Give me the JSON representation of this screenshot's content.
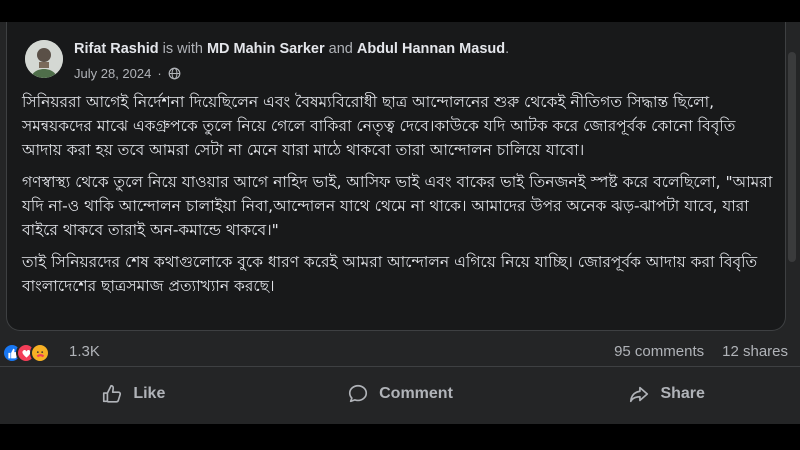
{
  "post": {
    "author": "Rifat Rashid",
    "with_text": "is with",
    "tagged_1": "MD Mahin Sarker",
    "and_text": "and",
    "tagged_2": "Abdul Hannan Masud",
    "date": "July 28, 2024",
    "separator": "·",
    "privacy_icon": "globe-icon",
    "paragraphs": [
      "সিনিয়ররা আগেই নির্দেশনা দিয়েছিলেন এবং বৈষম্যবিরোধী ছাত্র আন্দোলনের শুরু থেকেই নীতিগত সিদ্ধান্ত ছিলো, সমন্বয়কদের মাঝে একগ্রুপকে তুলে নিয়ে গেলে বাকিরা নেতৃত্ব দেবে।কাউকে যদি আটক করে জোরপূর্বক কোনো বিবৃতি আদায় করা হয় তবে আমরা সেটা না মেনে যারা মাঠে থাকবো তারা আন্দোলন চালিয়ে যাবো।",
      "গণস্বাস্থ্য থেকে তুলে নিয়ে যাওয়ার আগে নাহিদ ভাই, আসিফ ভাই এবং বাকের ভাই তিনজনই স্পষ্ট করে বলেছিলো, \"আমরা যদি না-ও থাকি আন্দোলন চালাইয়া নিবা,আন্দোলন যাথে থেমে না থাকে। আমাদের উপর অনেক ঝড়-ঝাপটা যাবে, যারা বাইরে থাকবে তারাই অন-কমান্ডে থাকবে।\"",
      "তাই সিনিয়রদের শেষ কথাগুলোকে বুকে ধারণ করেই আমরা আন্দোলন এগিয়ে নিয়ে যাচ্ছি। জোরপূর্বক আদায় করা বিবৃতি বাংলাদেশের ছাত্রসমাজ প্রত্যাখ্যান করছে।"
    ]
  },
  "stats": {
    "reaction_icons": [
      "like-icon",
      "love-icon",
      "care-icon"
    ],
    "reaction_count": "1.3K",
    "comments": "95 comments",
    "shares": "12 shares"
  },
  "actions": {
    "like": "Like",
    "comment": "Comment",
    "share": "Share"
  },
  "colors": {
    "background": "#242526",
    "card": "#18191a",
    "text": "#e4e6eb",
    "secondary": "#b0b3b8",
    "like_blue": "#1877f2",
    "love_red": "#f33e58",
    "care_yellow": "#f7b125"
  }
}
